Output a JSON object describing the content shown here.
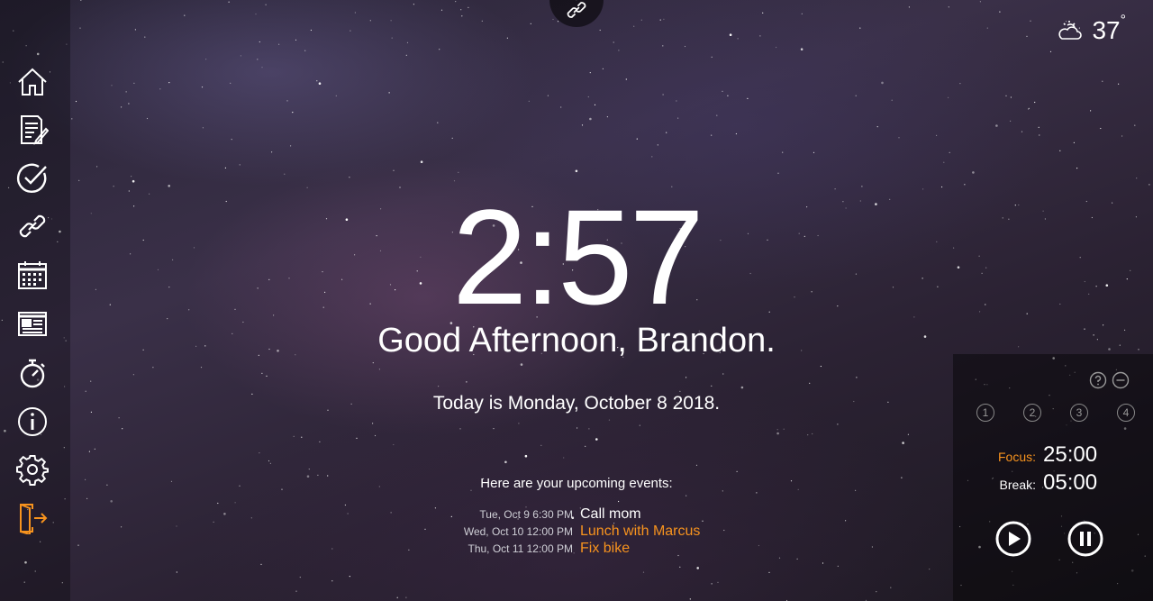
{
  "colors": {
    "accent": "#f7931e",
    "text": "#ffffff",
    "muted": "#cfcfd6"
  },
  "sidebar": {
    "items": [
      {
        "icon": "home-icon",
        "color": "#ffffff"
      },
      {
        "icon": "notes-icon",
        "color": "#ffffff"
      },
      {
        "icon": "todo-check-icon",
        "color": "#ffffff"
      },
      {
        "icon": "link-icon",
        "color": "#ffffff"
      },
      {
        "icon": "calendar-icon",
        "color": "#ffffff"
      },
      {
        "icon": "news-icon",
        "color": "#ffffff"
      },
      {
        "icon": "stopwatch-icon",
        "color": "#ffffff"
      },
      {
        "icon": "info-icon",
        "color": "#ffffff"
      },
      {
        "icon": "gear-icon",
        "color": "#ffffff"
      },
      {
        "icon": "logout-door-icon",
        "color": "#f7931e"
      }
    ]
  },
  "top_link": {
    "icon": "link-icon"
  },
  "weather": {
    "icon": "partly-cloudy-icon",
    "temp": "37",
    "unit": "°"
  },
  "clock": {
    "time": "2:57"
  },
  "greeting": "Good Afternoon, Brandon.",
  "today": "Today is Monday, October 8 2018.",
  "events": {
    "title": "Here are your upcoming events:",
    "items": [
      {
        "when": "Tue, Oct 9   6:30 PM",
        "title": "Call mom",
        "color": "#ffffff"
      },
      {
        "when": "Wed, Oct 10   12:00 PM",
        "title": "Lunch with Marcus",
        "color": "#f7931e"
      },
      {
        "when": "Thu, Oct 11   12:00 PM",
        "title": "Fix bike",
        "color": "#f7931e"
      }
    ]
  },
  "pomodoro": {
    "help_icon": "help-icon",
    "minimize_icon": "minus-circle-icon",
    "sessions": [
      "1",
      "2",
      "3",
      "4"
    ],
    "focus_label": "Focus:",
    "focus_value": "25:00",
    "break_label": "Break:",
    "break_value": "05:00",
    "play_icon": "play-icon",
    "pause_icon": "pause-icon"
  }
}
